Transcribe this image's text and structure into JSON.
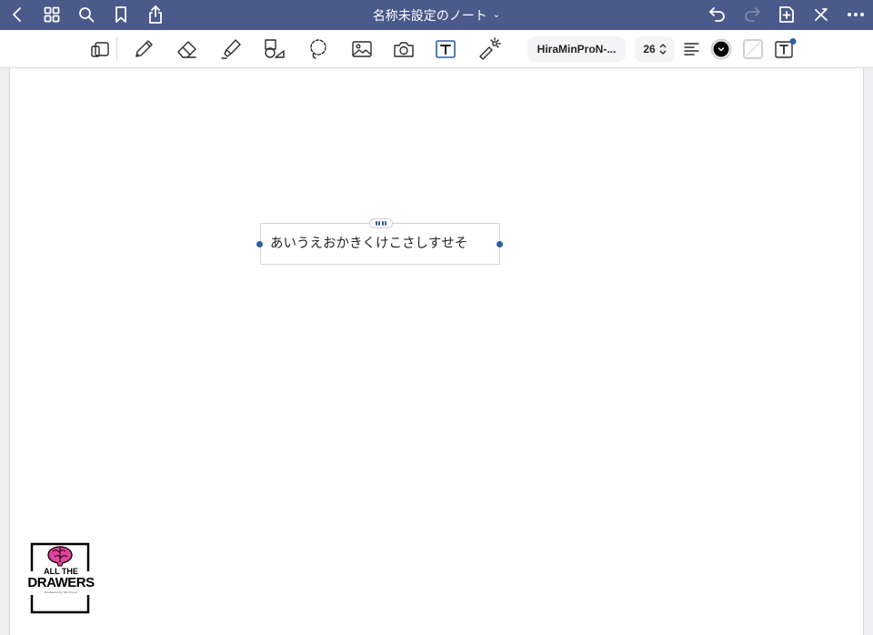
{
  "topbar": {
    "title": "名称未設定のノート",
    "title_chevron": "⌄",
    "left_icons": [
      "back-chevron-icon",
      "grid-icon",
      "search-icon",
      "bookmark-icon",
      "share-icon"
    ],
    "right_icons": [
      "undo-icon",
      "redo-icon",
      "add-page-icon",
      "close-tools-icon",
      "more-icon"
    ]
  },
  "toolbar": {
    "tools": [
      "device-mode-icon",
      "pen-icon",
      "eraser-icon",
      "highlighter-icon",
      "shapes-icon",
      "lasso-icon",
      "image-icon",
      "camera-icon",
      "text-tool-icon",
      "laser-pointer-icon"
    ],
    "font_name": "HiraMinProN-...",
    "font_size": "26",
    "text_color": "#000000",
    "accent_color": "#2d5f9e"
  },
  "page": {
    "textbox_text": "あいうえおかきくけこさしすせそ"
  },
  "logo": {
    "line1": "ALL THE",
    "line2": "DRAWERS",
    "line3": "Infodrawers by Toib Proven"
  }
}
